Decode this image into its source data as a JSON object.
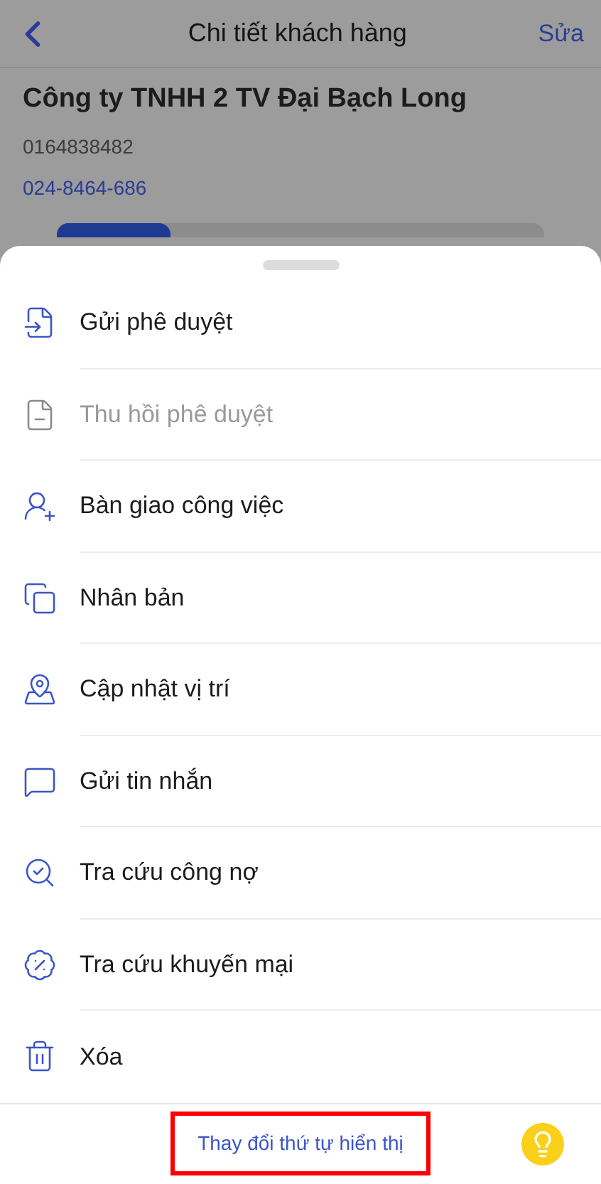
{
  "header": {
    "title": "Chi tiết khách hàng",
    "edit": "Sửa"
  },
  "customer": {
    "name": "Công ty TNHH 2 TV Đại Bạch Long",
    "phone": "0164838482",
    "phone_link": "024-8464-686"
  },
  "menu": [
    {
      "label": "Gửi phê duyệt",
      "disabled": false
    },
    {
      "label": "Thu hồi phê duyệt",
      "disabled": true
    },
    {
      "label": "Bàn giao công việc",
      "disabled": false
    },
    {
      "label": "Nhân bản",
      "disabled": false
    },
    {
      "label": "Cập nhật vị trí",
      "disabled": false
    },
    {
      "label": "Gửi tin nhắn",
      "disabled": false
    },
    {
      "label": "Tra cứu công nợ",
      "disabled": false
    },
    {
      "label": "Tra cứu khuyến mại",
      "disabled": false
    },
    {
      "label": "Xóa",
      "disabled": false
    }
  ],
  "footer": {
    "reorder": "Thay đổi thứ tự hiển thị",
    "highlighted": true
  }
}
